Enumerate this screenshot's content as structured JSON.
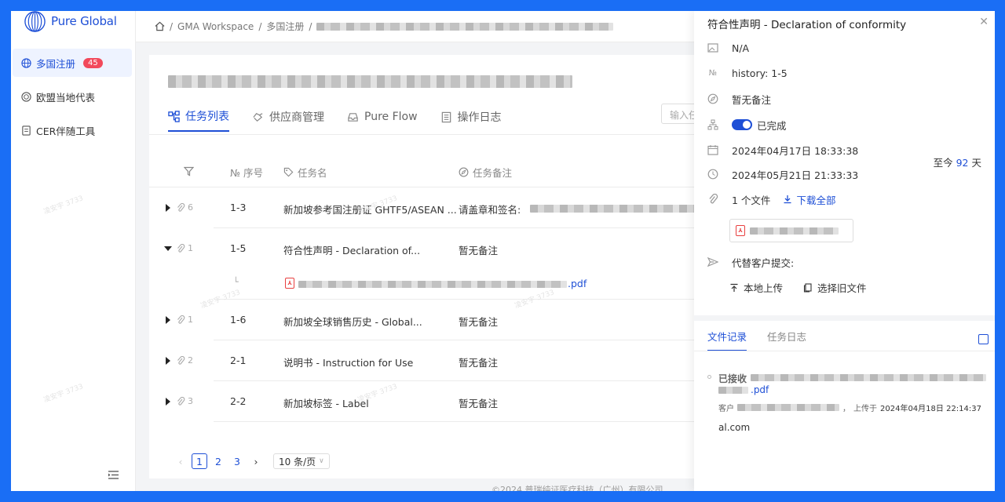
{
  "app": {
    "logo_text": "Pure Global"
  },
  "sidebar": {
    "items": [
      {
        "label": "多国注册",
        "badge": "45"
      },
      {
        "label": "欧盟当地代表"
      },
      {
        "label": "CER伴随工具"
      }
    ]
  },
  "breadcrumb": {
    "items": [
      "GMA Workspace",
      "多国注册"
    ]
  },
  "main": {
    "tabs": [
      {
        "label": "任务列表"
      },
      {
        "label": "供应商管理"
      },
      {
        "label": "Pure Flow"
      },
      {
        "label": "操作日志"
      }
    ],
    "search_placeholder": "输入任",
    "table": {
      "headers": [
        "№ 序号",
        "任务名",
        "任务备注"
      ],
      "rows": [
        {
          "count": "6",
          "seq": "1-3",
          "name": "新加坡参考国注册证 GHTF5/ASEAN ...",
          "note": "请盖章和签名:"
        },
        {
          "count": "1",
          "seq": "1-5",
          "name": "符合性声明 - Declaration of...",
          "note": "暂无备注",
          "attachment": ".pdf"
        },
        {
          "count": "1",
          "seq": "1-6",
          "name": "新加坡全球销售历史 - Global...",
          "note": "暂无备注"
        },
        {
          "count": "2",
          "seq": "2-1",
          "name": "说明书 - Instruction for Use",
          "note": "暂无备注"
        },
        {
          "count": "3",
          "seq": "2-2",
          "name": "新加坡标签 - Label",
          "note": "暂无备注"
        }
      ]
    },
    "pagination": {
      "pages": [
        "1",
        "2",
        "3"
      ],
      "current": "1",
      "page_size": "10 条/页"
    },
    "footer": "©2024 普瑞纯证医疗科技（广州）有限公司"
  },
  "watermark": "凌安宇 3733",
  "panel": {
    "title": "符合性声明 - Declaration of conformity",
    "category": "N/A",
    "history": "history: 1-5",
    "note": "暂无备注",
    "status": "已完成",
    "start_date": "2024年04月17日 18:33:38",
    "since_prefix": "至今",
    "since_days": "92",
    "since_suffix": "天",
    "end_date": "2024年05月21日 21:33:33",
    "file_count": "1 个文件",
    "download_all": "下载全部",
    "submit_label": "代替客户提交:",
    "upload_local": "本地上传",
    "choose_old": "选择旧文件",
    "tabs": [
      "文件记录",
      "任务日志"
    ],
    "record": {
      "status": "已接收",
      "file_ext": ".pdf",
      "uploader_prefix": "客户",
      "uploader_suffix": "al.com",
      "uploaded_label": "上传于",
      "uploaded_at": "2024年04月18日 22:14:37"
    }
  },
  "colors": {
    "accent": "#1e4fd6",
    "badge": "#f2495b",
    "frame": "#1a6ef5"
  }
}
